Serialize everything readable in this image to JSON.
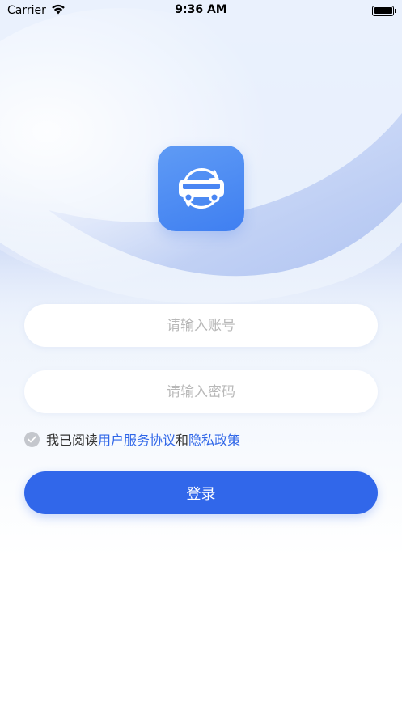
{
  "status_bar": {
    "carrier": "Carrier",
    "time": "9:36 AM",
    "wifi_icon": "wifi-icon",
    "battery_icon": "battery-icon"
  },
  "logo": {
    "icon": "bus-sync-icon",
    "color": "#4a86f3"
  },
  "form": {
    "account_placeholder": "请输入账号",
    "password_placeholder": "请输入密码",
    "account_value": "",
    "password_value": ""
  },
  "agreement": {
    "checked": true,
    "prefix": "我已阅读",
    "user_agreement": "用户服务协议",
    "and": "和",
    "privacy_policy": "隐私政策"
  },
  "login_button": {
    "label": "登录",
    "color": "#3167ea"
  }
}
